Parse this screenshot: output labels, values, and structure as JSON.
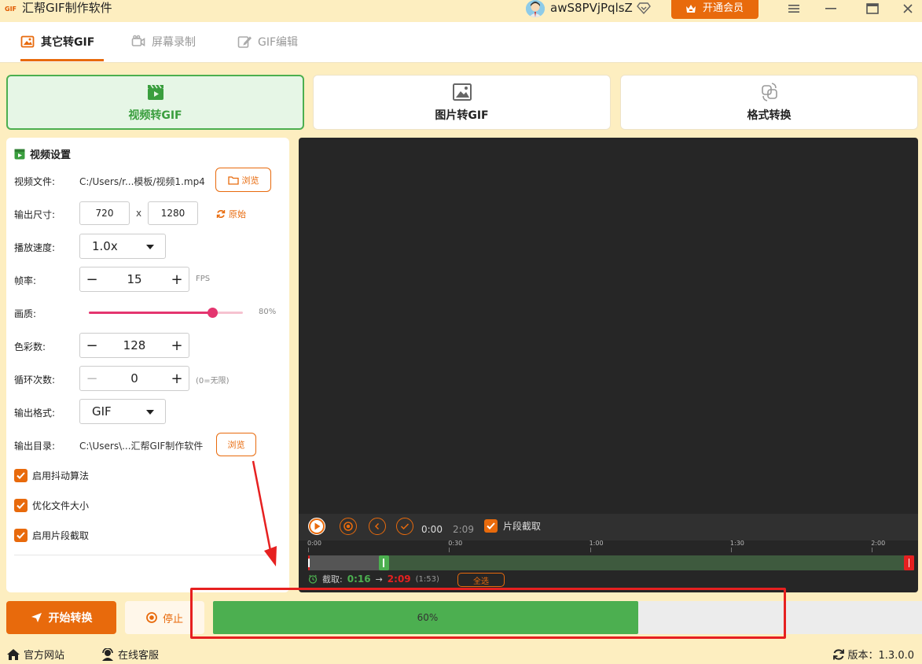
{
  "app": {
    "logo_text": "GIF",
    "title": "汇帮GIF制作软件"
  },
  "user": {
    "name": "awS8PVjPqlsZ",
    "vip_label": "开通会员"
  },
  "tabs": [
    {
      "label": "其它转GIF",
      "active": true
    },
    {
      "label": "屏幕录制",
      "active": false
    },
    {
      "label": "GIF编辑",
      "active": false
    }
  ],
  "modes": [
    {
      "label": "视频转GIF",
      "active": true
    },
    {
      "label": "图片转GIF",
      "active": false
    },
    {
      "label": "格式转换",
      "active": false
    }
  ],
  "settings": {
    "title": "视频设置",
    "video_file_label": "视频文件:",
    "video_file_path": "C:/Users/r...模板/视频1.mp4",
    "browse_label": "浏览",
    "size_label": "输出尺寸:",
    "width": "720",
    "times": "x",
    "height": "1280",
    "original_label": "原始",
    "speed_label": "播放速度:",
    "speed_value": "1.0x",
    "fps_label": "帧率:",
    "fps_value": "15",
    "fps_unit": "FPS",
    "quality_label": "画质:",
    "quality_value": "80%",
    "quality_fraction": 0.8,
    "colors_label": "色彩数:",
    "colors_value": "128",
    "loop_label": "循环次数:",
    "loop_value": "0",
    "loop_hint": "(0=无限)",
    "format_label": "输出格式:",
    "format_value": "GIF",
    "out_dir_label": "输出目录:",
    "out_dir_path": "C:\\Users\\...汇帮GIF制作软件",
    "out_dir_browse": "浏览",
    "minus": "−",
    "plus": "+",
    "checks": [
      {
        "label": "启用抖动算法",
        "checked": true
      },
      {
        "label": "优化文件大小",
        "checked": true
      },
      {
        "label": "启用片段截取",
        "checked": true
      }
    ]
  },
  "player": {
    "current_time": "0:00",
    "total_time": "2:09",
    "clip_label": "片段截取",
    "ruler": [
      "0:00",
      "0:30",
      "1:00",
      "1:30",
      "2:00"
    ],
    "ruler_seconds": [
      0,
      30,
      60,
      90,
      120
    ],
    "duration_seconds": 129,
    "clip_start_seconds": 16,
    "clip_end_seconds": 129,
    "clip_prefix": "截取:",
    "clip_start": "0:16",
    "arrow": "→",
    "clip_end": "2:09",
    "clip_duration": "(1:53)",
    "select_all": "全选"
  },
  "actions": {
    "start_label": "开始转换",
    "stop_label": "停止"
  },
  "progress": {
    "value": 0.6,
    "text": "60%"
  },
  "footer": {
    "website": "官方网站",
    "support": "在线客服",
    "version": "版本：1.3.0.0"
  },
  "colors": {
    "accent": "#e86a0c",
    "success": "#4caf50",
    "slider": "#e4356f",
    "annotation": "#e62020"
  }
}
